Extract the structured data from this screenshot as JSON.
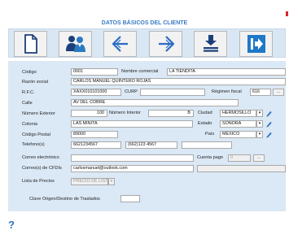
{
  "window": {
    "title": "DATOS BÁSICOS DEL CLIENTE"
  },
  "toolbar": {
    "buttons": [
      {
        "name": "new-document",
        "icon": "document-icon"
      },
      {
        "name": "users",
        "icon": "users-icon"
      },
      {
        "name": "back",
        "icon": "arrow-left-icon"
      },
      {
        "name": "forward",
        "icon": "arrow-right-icon"
      },
      {
        "name": "save",
        "icon": "download-stack-icon"
      },
      {
        "name": "exit",
        "icon": "exit-arrow-icon"
      }
    ]
  },
  "form": {
    "codigo_label": "Código",
    "codigo": "0001",
    "nombre_comercial_label": "Nombre comercial",
    "nombre_comercial": "LA TIENDITA",
    "razon_social_label": "Razón social",
    "razon_social": "CARLOS MANUEL QUINTERO ROJAS",
    "rfc_label": "R.F.C.",
    "rfc": "XAXX010101000",
    "curp_label": "CURP",
    "curp": "",
    "regimen_label": "Régimen fiscal",
    "regimen": "616",
    "regimen_btn": "...",
    "calle_label": "Calle",
    "calle": "AV DEL COBRE",
    "num_ext_label": "Número Exterior",
    "num_ext": "100",
    "num_int_label": "Número Interior",
    "num_int": "B",
    "ciudad_label": "Ciudad",
    "ciudad": "HERMOSILLO",
    "colonia_label": "Colonia",
    "colonia": "LAS MINITA",
    "estado_label": "Estado",
    "estado": "SONORA",
    "cp_label": "Código Postal",
    "cp": "89000",
    "pais_label": "País",
    "pais": "MÉXICO",
    "telefonos_label": "Telefono(s)",
    "tel1": "6621234567",
    "tel2": "(662)123 4567",
    "tel3": "",
    "correo_label": "Correo electrónico",
    "correo": "",
    "cuenta_pago_label": "Cuenta pago",
    "cuenta_pago": "0",
    "cuenta_pago_btn": "...",
    "correo_cfdi_label": "Correo(s) de CFDIs",
    "correo_cfdi": "carlosmanuel@outlook.com",
    "lista_precios_label": "Lista de Precios",
    "lista_precios": "PRECIO DE LISTA",
    "clave_label": "Clave Origen/Destino de Traslados",
    "clave": "",
    "dropdown_arrow": "▾"
  },
  "help": {
    "label": "?"
  },
  "colors": {
    "accent": "#3b7cc4",
    "panel": "#dbe8f5",
    "exit": "#1f78c8",
    "arrows": "#2b6cc4"
  }
}
